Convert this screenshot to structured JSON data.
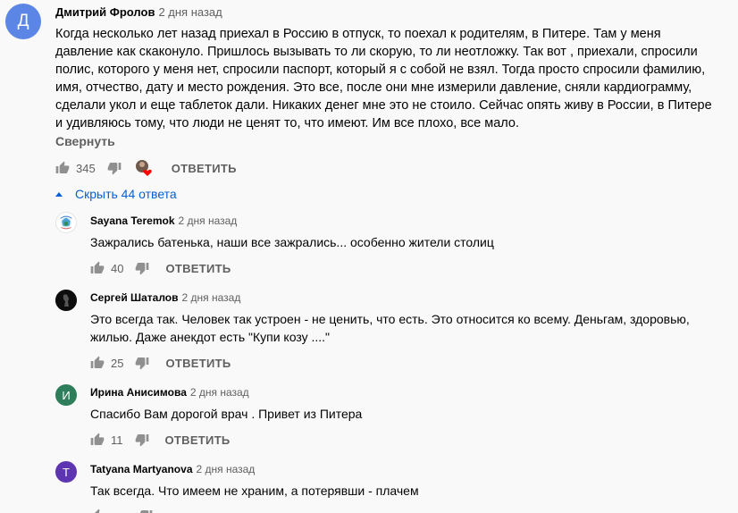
{
  "main_comment": {
    "avatar_letter": "Д",
    "author": "Дмитрий Фролов",
    "time": "2 дня назад",
    "text": "Когда несколько лет назад приехал в Россию в отпуск, то поехал к родителям, в Питере. Там у меня давление как скаконуло. Пришлось вызывать то ли скорую, то ли неотложку. Так вот , приехали, спросили полис, которого у меня нет, спросили паспорт, который я с собой не взял. Тогда просто спросили фамилию, имя, отчество, дату и место рождения. Это все, после они мне измерили давление, сняли кардиограмму, сделали укол и еще таблеток дали. Никаких денег мне это не стоило. Сейчас опять живу в России, в Питере и удивляюсь тому, что люди не ценят то, что имеют. Им все плохо, все мало.",
    "collapse_label": "Свернуть",
    "likes": "345",
    "reply_label": "ОТВЕТИТЬ"
  },
  "replies_toggle": {
    "label": "Скрыть 44 ответа"
  },
  "replies": [
    {
      "author": "Sayana Teremok",
      "time": "2 дня назад",
      "text": "Зажрались батенька, наши все зажрались... особенно жители столиц",
      "likes": "40",
      "reply_label": "ОТВЕТИТЬ",
      "avatar_letter": ""
    },
    {
      "author": "Сергей Шаталов",
      "time": "2 дня назад",
      "text": "Это всегда так. Человек так устроен - не ценить, что есть. Это относится ко всему. Деньгам, здоровью, жилью. Даже анекдот есть \"Купи козу ....\"",
      "likes": "25",
      "reply_label": "ОТВЕТИТЬ",
      "avatar_letter": ""
    },
    {
      "author": "Ирина Анисимова",
      "time": "2 дня назад",
      "text": "Спасибо Вам дорогой врач . Привет из Питера",
      "likes": "11",
      "reply_label": "ОТВЕТИТЬ",
      "avatar_letter": "И"
    },
    {
      "author": "Tatyana Martyanova",
      "time": "2 дня назад",
      "text": "Так всегда. Что имеем не храним, а потерявши - плачем",
      "likes": "",
      "reply_label": "",
      "avatar_letter": "T"
    }
  ],
  "colors": {
    "main_avatar": "#5b86e5",
    "irina_avatar": "#2e7d5b",
    "tatyana_avatar": "#5e35b1",
    "link": "#065fd4",
    "heart": "#ff0000"
  }
}
